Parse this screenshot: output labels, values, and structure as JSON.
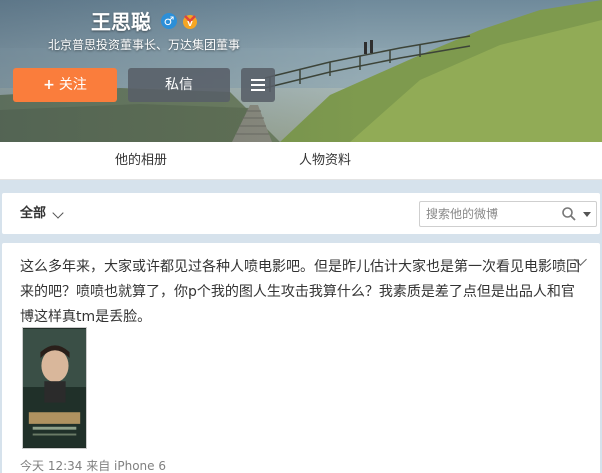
{
  "profile": {
    "name": "王思聪",
    "gender_icon_glyph": "♂",
    "description": "北京普思投资董事长、万达集团董事",
    "badge_icon": "vip-badge-icon"
  },
  "actions": {
    "follow_plus": "+",
    "follow_label": "关注",
    "message_label": "私信",
    "menu_icon": "menu-icon"
  },
  "tabs": [
    {
      "label": "他的相册"
    },
    {
      "label": "人物资料"
    }
  ],
  "filter": {
    "selected": "全部",
    "search_placeholder": "搜索他的微博"
  },
  "post": {
    "text": "这么多年来，大家或许都见过各种人喷电影吧。但是昨儿估计大家也是第一次看见电影喷回来的吧？喷喷也就算了，你p个我的图人生攻击我算什么？我素质是差了点但是出品人和官博这样真tm是丢脸。",
    "meta": "今天 12:34 来自 iPhone 6"
  },
  "colors": {
    "follow_button": "#fa7d3c",
    "page_background": "#d6e2ec",
    "verify_blue": "#2c8fd8"
  }
}
